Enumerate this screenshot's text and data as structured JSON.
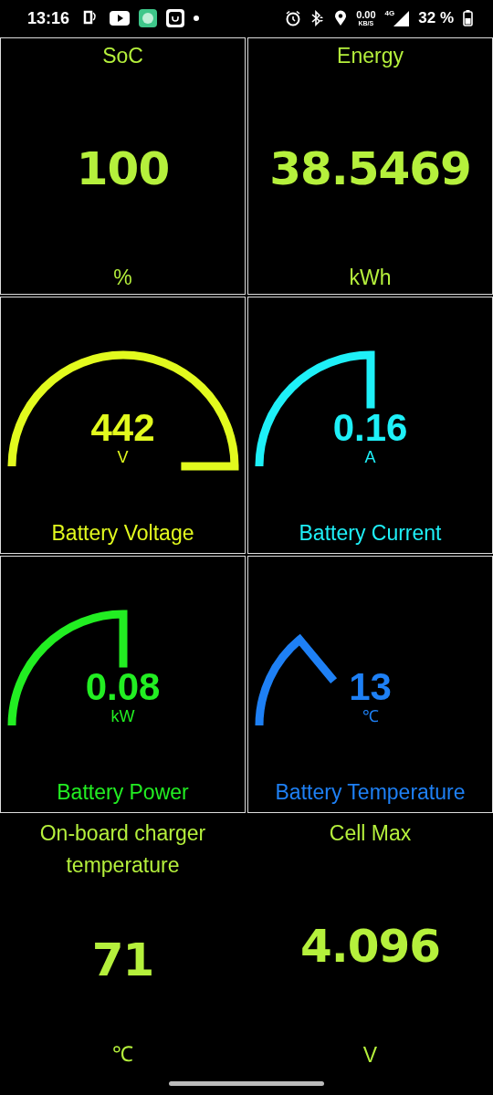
{
  "status_bar": {
    "time": "13:16",
    "net_speed": "0.00",
    "net_unit": "KB/S",
    "network": "4G",
    "battery": "32 %"
  },
  "tiles": [
    {
      "kind": "number",
      "title": "SoC",
      "value": "100",
      "unit": "%",
      "color": "#b5f03c",
      "bordered": true
    },
    {
      "kind": "number",
      "title": "Energy",
      "value": "38.5469",
      "unit": "kWh",
      "color": "#b5f03c",
      "bordered": true
    },
    {
      "kind": "gauge",
      "title": "Battery Voltage",
      "value": "442",
      "unit": "V",
      "color": "#e2fa1e",
      "bordered": true
    },
    {
      "kind": "gauge",
      "title": "Battery Current",
      "value": "0.16",
      "unit": "A",
      "color": "#1ef0f8",
      "bordered": true
    },
    {
      "kind": "gauge",
      "title": "Battery Power",
      "value": "0.08",
      "unit": "kW",
      "color": "#22ee22",
      "bordered": true
    },
    {
      "kind": "gauge",
      "title": "Battery Temperature",
      "value": "13",
      "unit": "℃",
      "color": "#1e80f5",
      "bordered": true
    },
    {
      "kind": "number",
      "title": "On-board charger temperature",
      "value": "71",
      "unit": "℃",
      "color": "#b5f03c",
      "bordered": false
    },
    {
      "kind": "number",
      "title": "Cell Max",
      "value": "4.096",
      "unit": "V",
      "color": "#b5f03c",
      "bordered": false
    }
  ]
}
